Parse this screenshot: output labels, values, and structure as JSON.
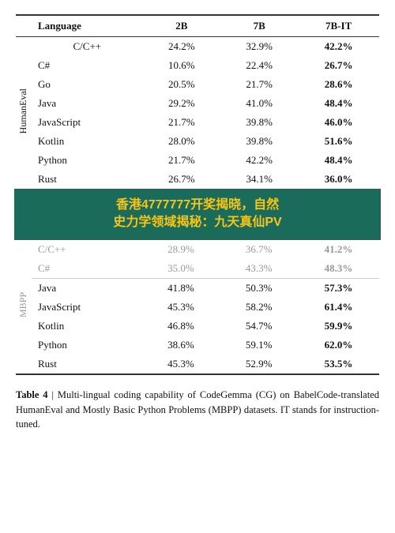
{
  "table": {
    "columns": [
      "Language",
      "2B",
      "7B",
      "7B-IT"
    ],
    "humaneval_label": "HumanEval",
    "mbpp_label": "MBPP",
    "humaneval_rows": [
      {
        "language": "C/C++",
        "b2": "24.2%",
        "b7": "32.9%",
        "b7it": "42.2%",
        "bold": true
      },
      {
        "language": "C#",
        "b2": "10.6%",
        "b7": "22.4%",
        "b7it": "26.7%",
        "bold": true
      },
      {
        "language": "Go",
        "b2": "20.5%",
        "b7": "21.7%",
        "b7it": "28.6%",
        "bold": true
      },
      {
        "language": "Java",
        "b2": "29.2%",
        "b7": "41.0%",
        "b7it": "48.4%",
        "bold": true
      },
      {
        "language": "JavaScript",
        "b2": "21.7%",
        "b7": "39.8%",
        "b7it": "46.0%",
        "bold": true
      },
      {
        "language": "Kotlin",
        "b2": "28.0%",
        "b7": "39.8%",
        "b7it": "51.6%",
        "bold": true
      },
      {
        "language": "Python",
        "b2": "21.7%",
        "b7": "42.2%",
        "b7it": "48.4%",
        "bold": true
      },
      {
        "language": "Rust",
        "b2": "26.7%",
        "b7": "34.1%",
        "b7it": "36.0%",
        "bold": true
      }
    ],
    "overlay_rows": [
      {
        "language": "C/C++",
        "b2": "28.9%",
        "b7": "36.7%",
        "b7it": "41.2%"
      },
      {
        "language": "C#",
        "b2": "35.0%",
        "b7": "43.3%",
        "b7it": "48.3%"
      }
    ],
    "mbpp_rows": [
      {
        "language": "Java",
        "b2": "41.8%",
        "b7": "50.3%",
        "b7it": "57.3%",
        "bold": true
      },
      {
        "language": "JavaScript",
        "b2": "45.3%",
        "b7": "58.2%",
        "b7it": "61.4%",
        "bold": true
      },
      {
        "language": "Kotlin",
        "b2": "46.8%",
        "b7": "54.7%",
        "b7it": "59.9%",
        "bold": true
      },
      {
        "language": "Python",
        "b2": "38.6%",
        "b7": "59.1%",
        "b7it": "62.0%",
        "bold": true
      },
      {
        "language": "Rust",
        "b2": "45.3%",
        "b7": "52.9%",
        "b7it": "53.5%",
        "bold": true
      }
    ]
  },
  "overlay": {
    "text_line1": "香港4777777开奖揭晓，自然",
    "text_line2": "史力学领域揭秘：九天真仙PV"
  },
  "caption": {
    "label": "Table 4",
    "separator": " | ",
    "text": "Multi-lingual coding capability of CodeGemma (CG) on BabelCode-translated HumanEval and Mostly Basic Python Problems (MBPP) datasets. IT stands for instruction-tuned."
  }
}
